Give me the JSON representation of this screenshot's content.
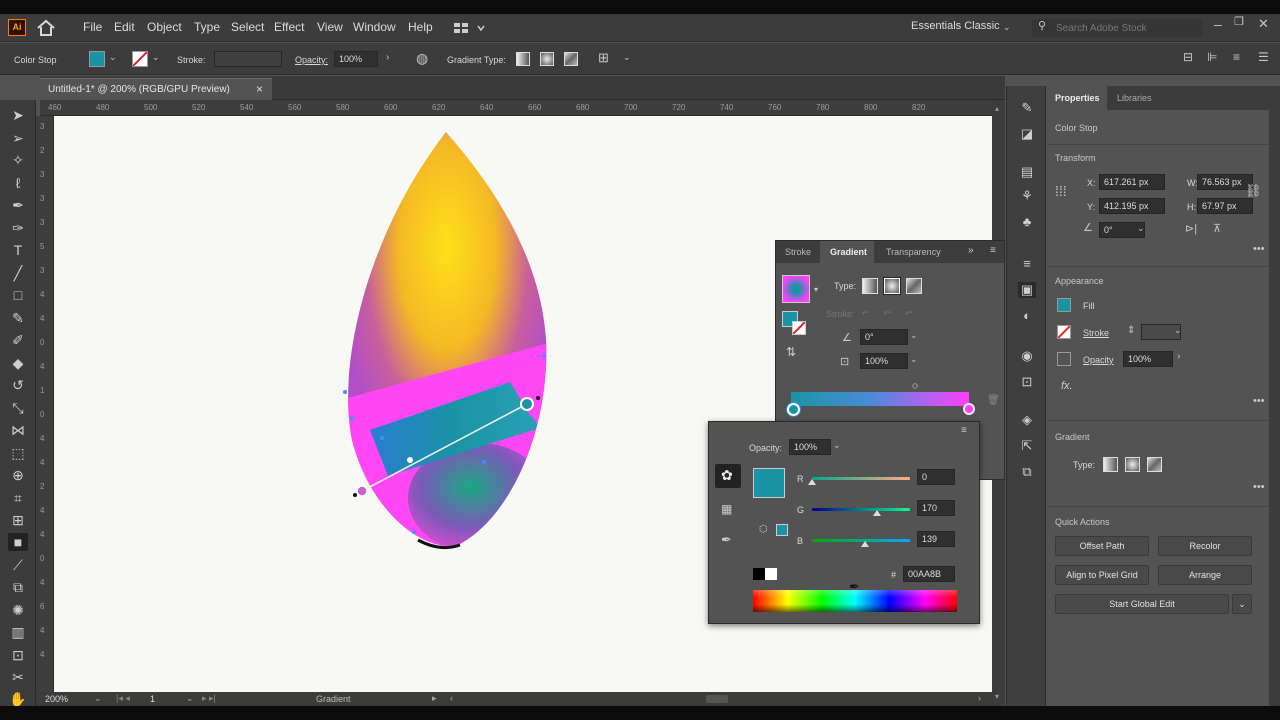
{
  "app": {
    "logo": "Ai"
  },
  "menu": [
    "File",
    "Edit",
    "Object",
    "Type",
    "Select",
    "Effect",
    "View",
    "Window",
    "Help"
  ],
  "workspace": "Essentials Classic",
  "search_placeholder": "Search Adobe Stock",
  "control_bar": {
    "selection": "Color Stop",
    "stroke_label": "Stroke:",
    "opacity_label": "Opacity:",
    "opacity_value": "100%",
    "gradient_type_label": "Gradient Type:"
  },
  "document_tab": {
    "title": "Untitled-1* @ 200% (RGB/GPU Preview)",
    "close": "×"
  },
  "ruler_h": [
    "460",
    "480",
    "500",
    "520",
    "540",
    "560",
    "580",
    "600",
    "620",
    "640",
    "660",
    "680",
    "700",
    "720",
    "740",
    "760",
    "780",
    "800",
    "820"
  ],
  "ruler_v": [
    "3",
    "2",
    "3",
    "3",
    "3",
    "5",
    "3",
    "4",
    "4",
    "0",
    "4",
    "1",
    "0",
    "4",
    "4",
    "2",
    "4",
    "4",
    "0",
    "4",
    "6",
    "4",
    "4"
  ],
  "status": {
    "zoom": "200%",
    "artboard": "1",
    "tool": "Gradient"
  },
  "gradient_panel": {
    "tabs": [
      "Stroke",
      "Gradient",
      "Transparency"
    ],
    "type_label": "Type:",
    "stroke_label": "Stroke:",
    "angle": "0°",
    "aspect": "100%"
  },
  "color_panel": {
    "opacity_label": "Opacity:",
    "opacity_value": "100%",
    "r_label": "R",
    "r_value": "0",
    "g_label": "G",
    "g_value": "170",
    "b_label": "B",
    "b_value": "139",
    "hex_label": "#",
    "hex_value": "00AA8B",
    "r_fraction": 0.0,
    "g_fraction": 0.667,
    "b_fraction": 0.545
  },
  "properties": {
    "tabs": [
      "Properties",
      "Libraries"
    ],
    "selection": "Color Stop",
    "transform_title": "Transform",
    "x_label": "X:",
    "x_value": "617.261 px",
    "y_label": "Y:",
    "y_value": "412.195 px",
    "w_label": "W:",
    "w_value": "76.563 px",
    "h_label": "H:",
    "h_value": "67.97 px",
    "rotate_value": "0°",
    "appearance_title": "Appearance",
    "fill_label": "Fill",
    "stroke_label": "Stroke",
    "opacity_label": "Opacity",
    "opacity_value": "100%",
    "fx_label": "fx.",
    "gradient_title": "Gradient",
    "gradient_type_label": "Type:",
    "quick_actions_title": "Quick Actions",
    "btn_offset": "Offset Path",
    "btn_recolor": "Recolor",
    "btn_align": "Align to Pixel Grid",
    "btn_arrange": "Arrange",
    "btn_global": "Start Global Edit"
  },
  "colors": {
    "fill_teal": "#1a94a4",
    "magenta": "#ff40ff",
    "accent_blue": "#2f8fd8"
  }
}
